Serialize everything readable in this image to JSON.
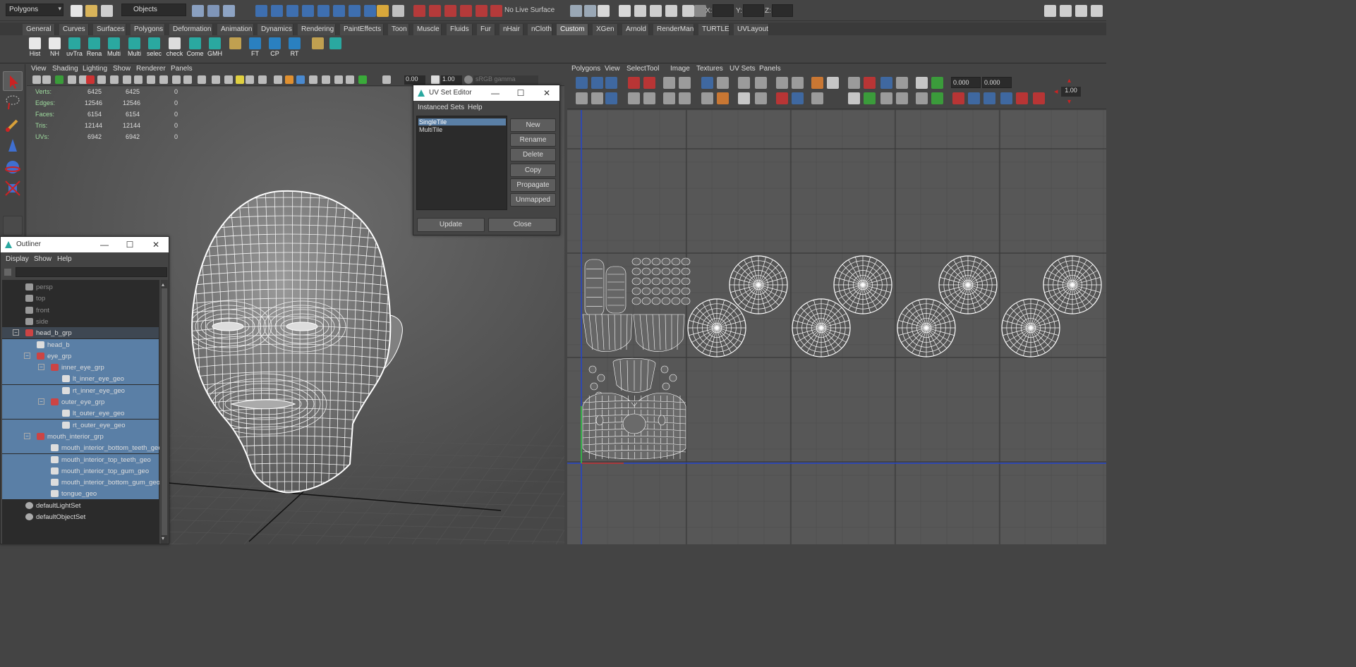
{
  "status_line": {
    "mode": "Polygons",
    "selection_mode": "Objects",
    "live_surface": "No Live Surface",
    "coord_labels": [
      "X:",
      "Y:",
      "Z:"
    ]
  },
  "shelf": {
    "tabs": [
      "General",
      "Curves",
      "Surfaces",
      "Polygons",
      "Deformation",
      "Animation",
      "Dynamics",
      "Rendering",
      "PaintEffects",
      "Toon",
      "Muscle",
      "Fluids",
      "Fur",
      "nHair",
      "nCloth",
      "Custom",
      "XGen",
      "Arnold",
      "RenderMan",
      "TURTLE",
      "UVLayout"
    ],
    "active_tab": "Custom",
    "buttons": [
      "Hist",
      "NH",
      "uvTra",
      "Rena",
      "Multi",
      "Multi",
      "selec",
      "check",
      "Come",
      "GMH",
      "",
      "FT",
      "CP",
      "RT",
      "",
      ""
    ]
  },
  "viewport": {
    "menu": [
      "View",
      "Shading",
      "Lighting",
      "Show",
      "Renderer",
      "Panels"
    ],
    "exposure": "0.00",
    "gamma": "1.00",
    "color_space": "sRGB gamma",
    "hud": {
      "labels": [
        "Verts:",
        "Edges:",
        "Faces:",
        "Tris:",
        "UVs:"
      ],
      "col1": [
        "6425",
        "12546",
        "6154",
        "12144",
        "6942"
      ],
      "col2": [
        "6425",
        "12546",
        "6154",
        "12144",
        "6942"
      ],
      "col3": [
        "0",
        "0",
        "0",
        "0",
        "0"
      ]
    }
  },
  "uv_editor": {
    "menu": [
      "Polygons",
      "View",
      "Select",
      "Tool",
      "Image",
      "Textures",
      "UV Sets",
      "Panels"
    ],
    "u_value": "0.000",
    "v_value": "0.000",
    "scale": "1.00"
  },
  "uv_set_editor": {
    "title": "UV Set Editor",
    "menu": [
      "Instanced Sets",
      "Help"
    ],
    "sets": [
      "SingleTile",
      "MultiTile"
    ],
    "selected": "SingleTile",
    "buttons": [
      "New",
      "Rename",
      "Delete",
      "Copy",
      "Propagate",
      "Unmapped"
    ],
    "update_label": "Update",
    "close_label": "Close"
  },
  "outliner": {
    "title": "Outliner",
    "menu": [
      "Display",
      "Show",
      "Help"
    ],
    "items": [
      {
        "label": "persp",
        "indent": 0
      },
      {
        "label": "top",
        "indent": 0
      },
      {
        "label": "front",
        "indent": 0
      },
      {
        "label": "side",
        "indent": 0
      },
      {
        "label": "head_b_grp",
        "indent": 0
      },
      {
        "label": "head_b",
        "indent": 1
      },
      {
        "label": "eye_grp",
        "indent": 1
      },
      {
        "label": "inner_eye_grp",
        "indent": 2
      },
      {
        "label": "lt_inner_eye_geo",
        "indent": 3
      },
      {
        "label": "rt_inner_eye_geo",
        "indent": 3
      },
      {
        "label": "outer_eye_grp",
        "indent": 2
      },
      {
        "label": "lt_outer_eye_geo",
        "indent": 3
      },
      {
        "label": "rt_outer_eye_geo",
        "indent": 3
      },
      {
        "label": "mouth_interior_grp",
        "indent": 1
      },
      {
        "label": "mouth_interior_bottom_teeth_geo",
        "indent": 2
      },
      {
        "label": "mouth_interior_top_teeth_geo",
        "indent": 2
      },
      {
        "label": "mouth_interior_top_gum_geo",
        "indent": 2
      },
      {
        "label": "mouth_interior_bottom_gum_geo",
        "indent": 2
      },
      {
        "label": "tongue_geo",
        "indent": 2
      },
      {
        "label": "defaultLightSet",
        "indent": 0
      },
      {
        "label": "defaultObjectSet",
        "indent": 0
      }
    ]
  }
}
